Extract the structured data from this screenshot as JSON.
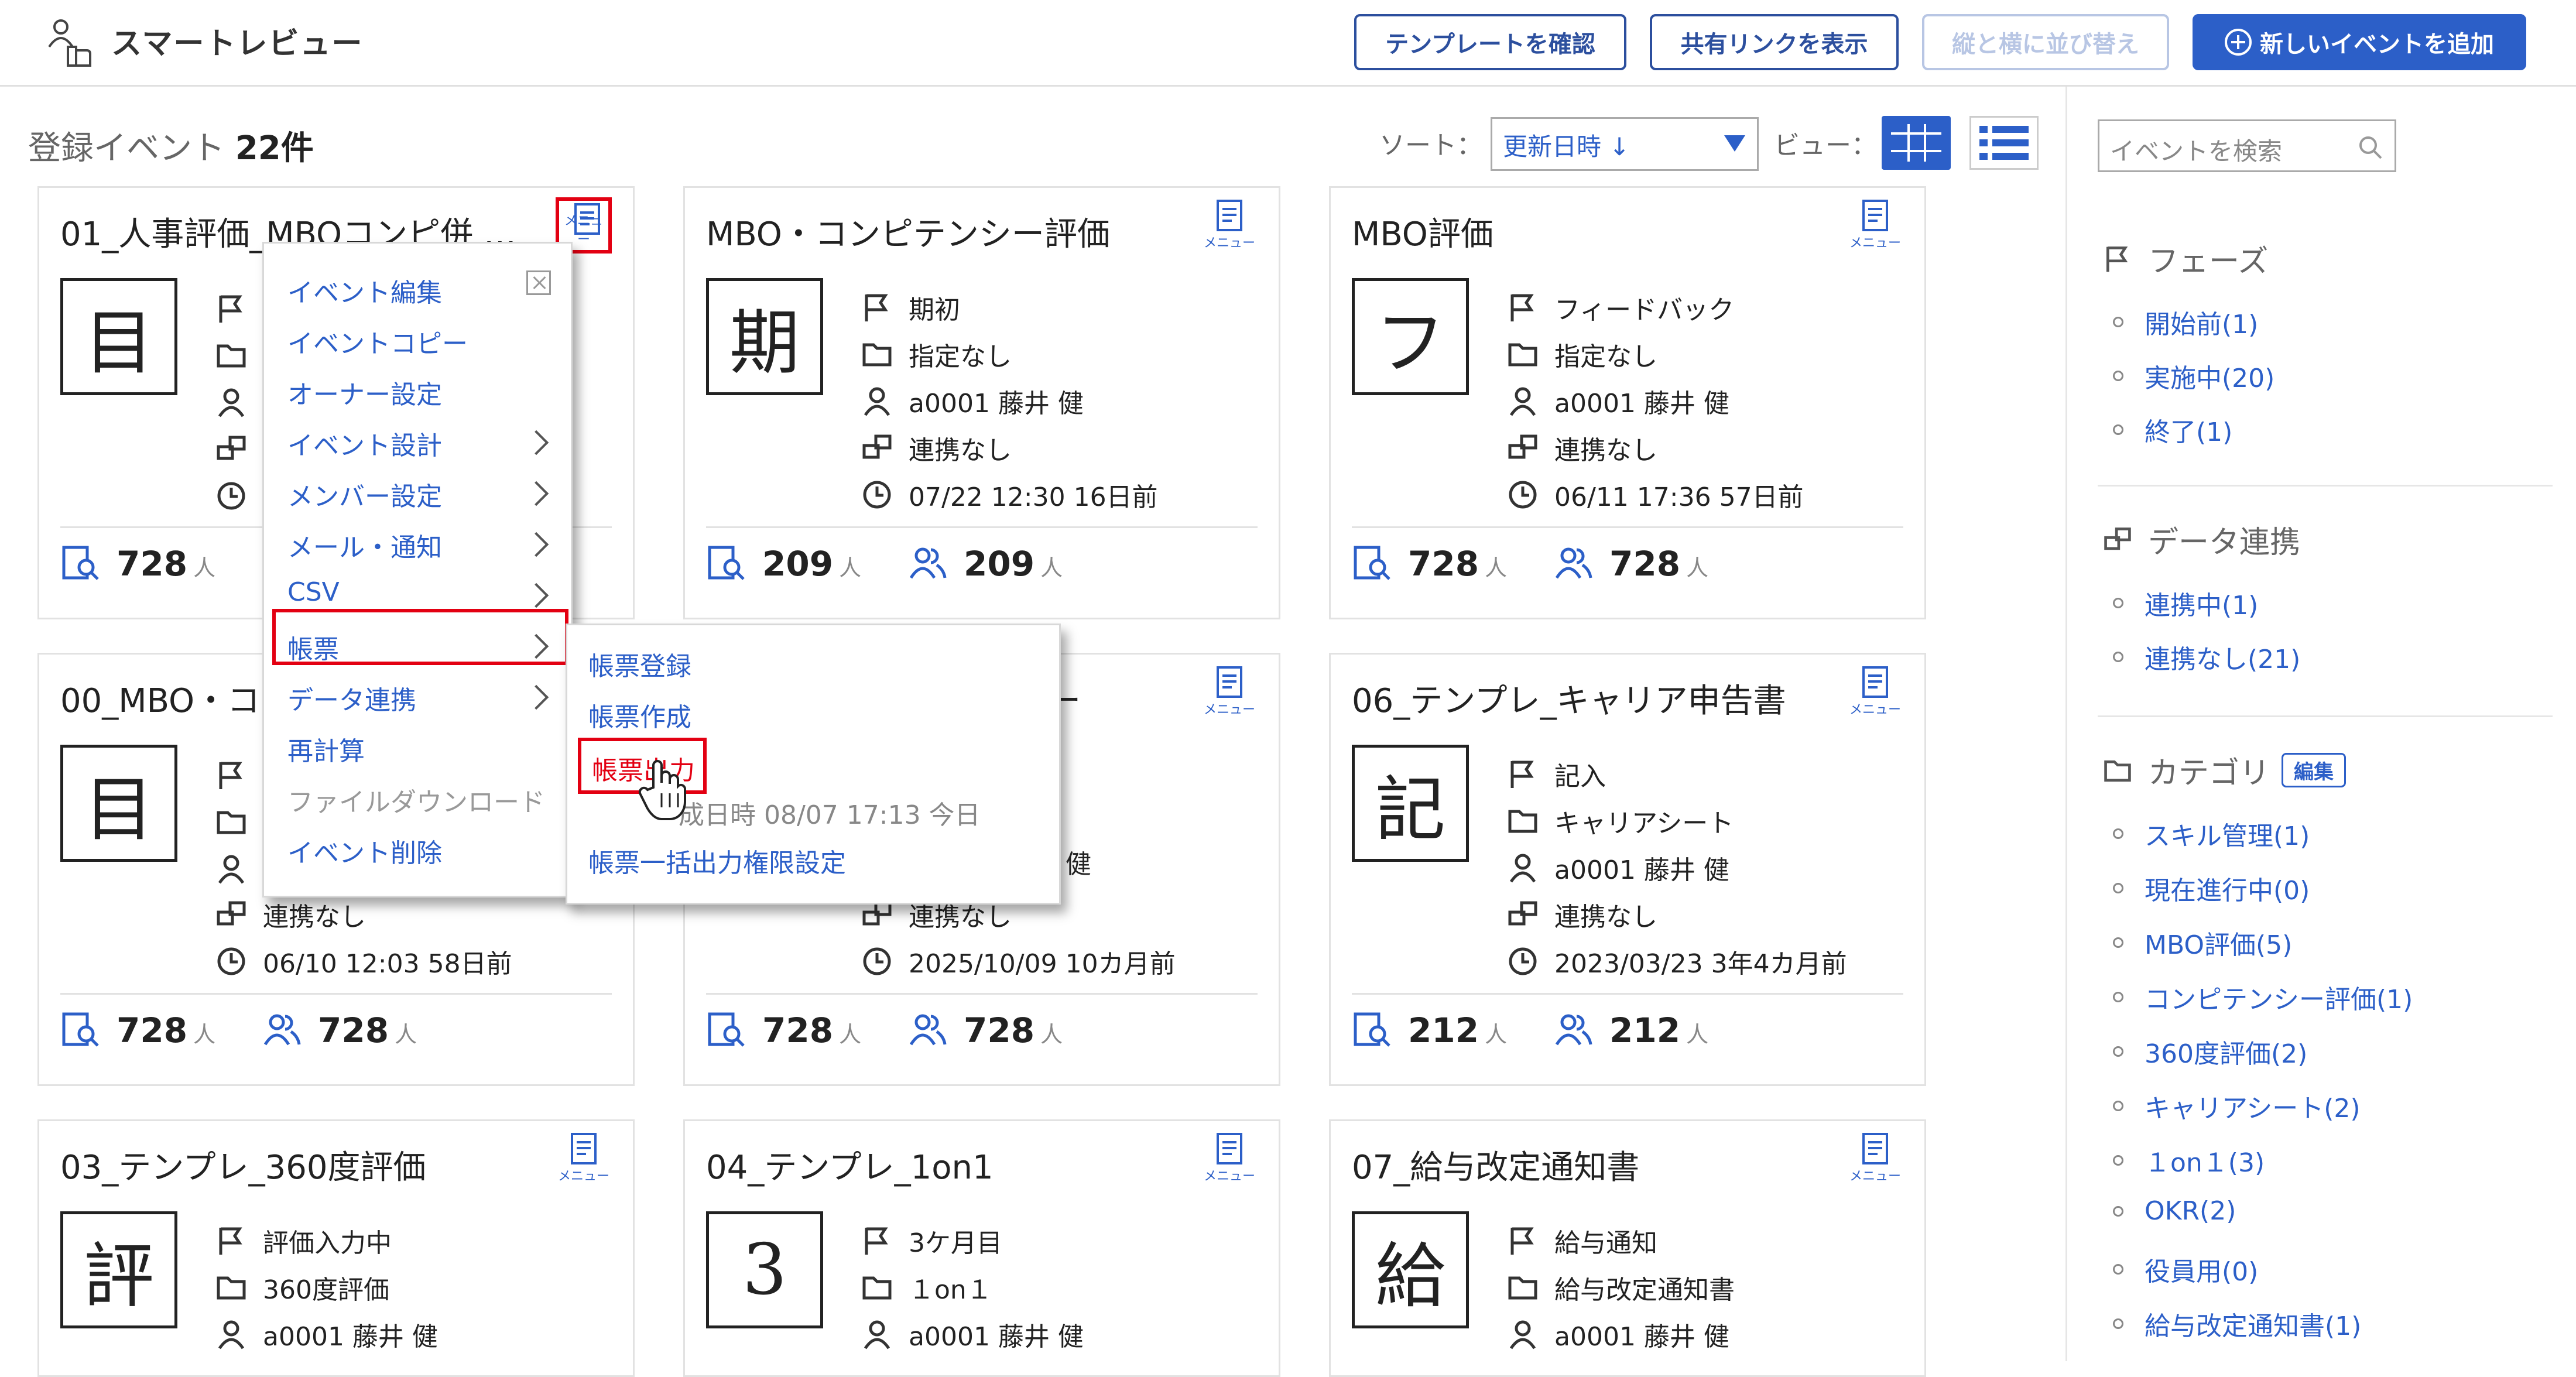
{
  "header": {
    "app_title": "スマートレビュー",
    "buttons": {
      "template": "テンプレートを確認",
      "share": "共有リンクを表示",
      "arrange": "縦と横に並び替え",
      "add_event": "新しいイベントを追加"
    }
  },
  "toolbar": {
    "count_prefix": "登録イベント",
    "count_value": "22件",
    "sort_label": "ソート：",
    "sort_value": "更新日時 ↓",
    "view_label": "ビュー："
  },
  "menu_label": "メニュー",
  "cards": [
    {
      "title": "01_人事評価_MBOコンピ併 …",
      "char": "目",
      "phase": "",
      "category": "",
      "owner": "",
      "link": "",
      "date": "",
      "stat1": "728",
      "stat2": "",
      "unit": "人"
    },
    {
      "title": "MBO・コンピテンシー評価",
      "char": "期",
      "phase": "期初",
      "category": "指定なし",
      "owner": "a0001 藤井 健",
      "link": "連携なし",
      "date": "07/22 12:30 16日前",
      "stat1": "209",
      "stat2": "209",
      "unit": "人"
    },
    {
      "title": "MBO評価",
      "char": "フ",
      "phase": "フィードバック",
      "category": "指定なし",
      "owner": "a0001 藤井 健",
      "link": "連携なし",
      "date": "06/11 17:36 57日前",
      "stat1": "728",
      "stat2": "728",
      "unit": "人"
    },
    {
      "title": "00_MBO・コ",
      "char": "目",
      "phase": "",
      "category": "",
      "owner": "",
      "link": "連携なし",
      "date": "06/10 12:03 58日前",
      "stat1": "728",
      "stat2": "728",
      "unit": "人"
    },
    {
      "title": "ー",
      "char": "",
      "phase": "",
      "category": "",
      "owner": "",
      "link": "連携なし",
      "date": "2025/10/09 10カ月前",
      "stat1": "728",
      "stat2": "728",
      "unit": "人"
    },
    {
      "title": "06_テンプレ_キャリア申告書",
      "char": "記",
      "phase": "記入",
      "category": "キャリアシート",
      "owner": "a0001 藤井 健",
      "link": "連携なし",
      "date": "2023/03/23 3年4カ月前",
      "stat1": "212",
      "stat2": "212",
      "unit": "人"
    },
    {
      "title": "03_テンプレ_360度評価",
      "char": "評",
      "phase": "評価入力中",
      "category": "360度評価",
      "owner": "a0001 藤井 健"
    },
    {
      "title": "04_テンプレ_1on1",
      "char": "3",
      "phase": "3ケ月目",
      "category": "１on１",
      "owner": "a0001 藤井 健"
    },
    {
      "title": "07_給与改定通知書",
      "char": "給",
      "phase": "給与通知",
      "category": "給与改定通知書",
      "owner": "a0001 藤井 健"
    }
  ],
  "context_menu": {
    "items": [
      "イベント編集",
      "イベントコピー",
      "オーナー設定",
      "イベント設計",
      "メンバー設定",
      "メール・通知",
      "CSV",
      "帳票",
      "データ連携",
      "再計算",
      "ファイルダウンロード",
      "イベント削除"
    ]
  },
  "submenu": {
    "items": [
      "帳票登録",
      "帳票作成",
      "帳票出力",
      "帳票一括出力権限設定"
    ],
    "partial_text": "成日時 08/07 17:13 今日",
    "partial_right": "健"
  },
  "sidebar": {
    "search_placeholder": "イベントを検索",
    "phase_head": "フェーズ",
    "phase_items": [
      "開始前(1)",
      "実施中(20)",
      "終了(1)"
    ],
    "link_head": "データ連携",
    "link_items": [
      "連携中(1)",
      "連携なし(21)"
    ],
    "category_head": "カテゴリ",
    "category_edit": "編集",
    "category_items": [
      "スキル管理(1)",
      "現在進行中(0)",
      "MBO評価(5)",
      "コンピテンシー評価(1)",
      "360度評価(2)",
      "キャリアシート(2)",
      "１on１(3)",
      "OKR(2)",
      "役員用(0)",
      "給与改定通知書(1)"
    ]
  },
  "colors": {
    "accent": "#2c5fc8",
    "highlight": "#e30012"
  }
}
